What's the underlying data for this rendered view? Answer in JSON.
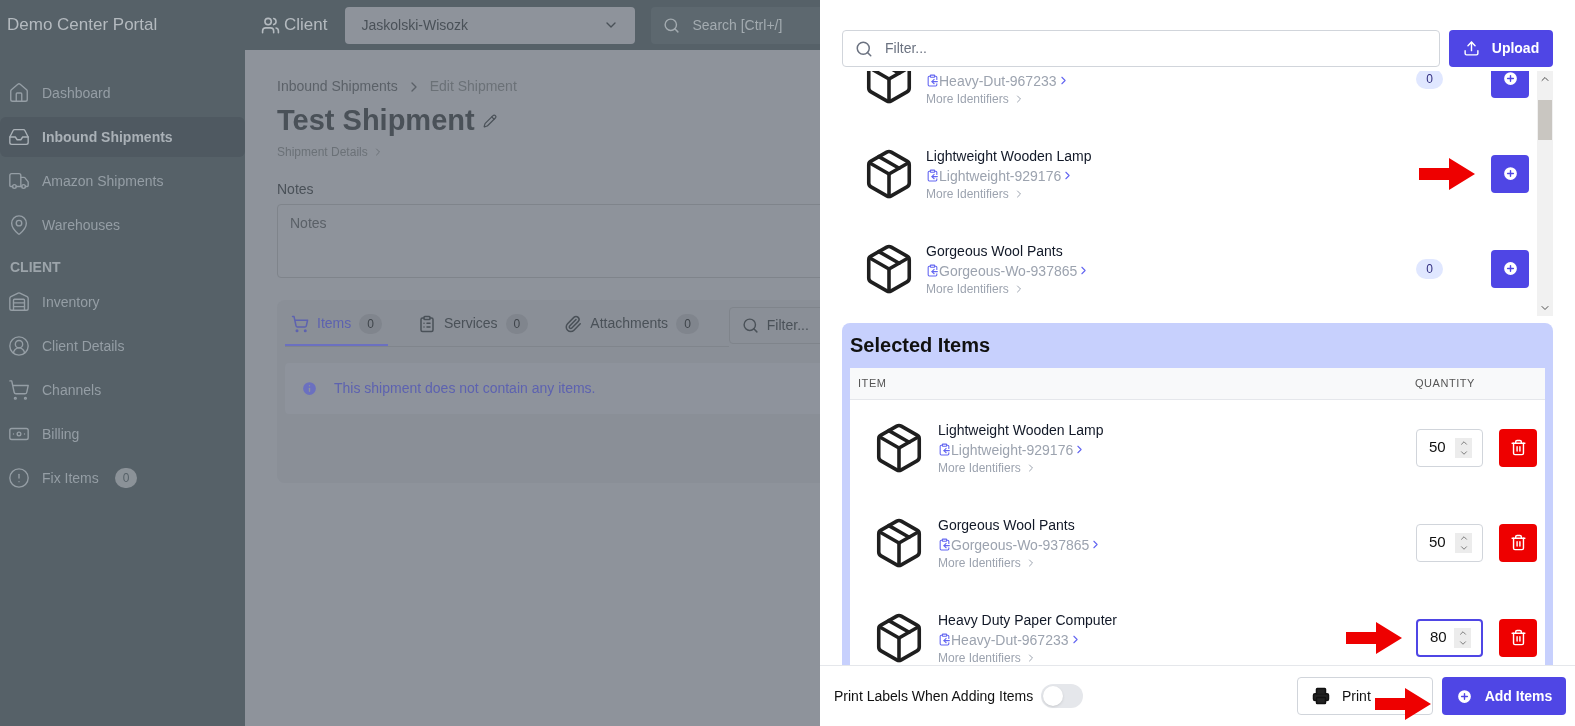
{
  "app": {
    "title": "Demo Center Portal",
    "client_label": "Client",
    "client_select": "Jaskolski-Wisozk",
    "search": {
      "placeholder": "Search [Ctrl+/]"
    }
  },
  "sidebar": {
    "items": [
      {
        "label": "Dashboard",
        "selected": false
      },
      {
        "label": "Inbound Shipments",
        "selected": true
      },
      {
        "label": "Amazon Shipments",
        "selected": false
      },
      {
        "label": "Warehouses",
        "selected": false
      }
    ],
    "section": "CLIENT",
    "client_items": [
      {
        "label": "Inventory",
        "selected": false
      },
      {
        "label": "Client Details",
        "selected": false
      },
      {
        "label": "Channels",
        "selected": false
      },
      {
        "label": "Billing",
        "selected": false
      },
      {
        "label": "Fix Items",
        "selected": false,
        "badge": "0"
      }
    ]
  },
  "page": {
    "breadcrumb": [
      "Inbound Shipments",
      "Edit Shipment"
    ],
    "title": "Test Shipment",
    "subtitle": "Shipment Details",
    "notes_label": "Notes",
    "notes_placeholder": "Notes",
    "tabs": [
      {
        "label": "Items",
        "count": "0",
        "selected": true
      },
      {
        "label": "Services",
        "count": "0",
        "selected": false
      },
      {
        "label": "Attachments",
        "count": "0",
        "selected": false
      }
    ],
    "filter_placeholder": "Filter...",
    "empty_message": "This shipment does not contain any items."
  },
  "drawer": {
    "filter_placeholder": "Filter...",
    "upload": "Upload",
    "catalog": [
      {
        "sku": "Heavy-Dut-967233",
        "more": "More Identifiers",
        "count": "0",
        "arrow": false
      },
      {
        "name": "Lightweight Wooden Lamp",
        "sku": "Lightweight-929176",
        "more": "More Identifiers",
        "arrow": true
      },
      {
        "name": "Gorgeous Wool Pants",
        "sku": "Gorgeous-Wo-937865",
        "more": "More Identifiers",
        "count": "0",
        "arrow": false
      }
    ],
    "selected_title": "Selected Items",
    "columns": [
      "ITEM",
      "QUANTITY"
    ],
    "selected": [
      {
        "name": "Lightweight Wooden Lamp",
        "sku": "Lightweight-929176",
        "more": "More Identifiers",
        "quantity": "50",
        "focused": false,
        "arrow": false
      },
      {
        "name": "Gorgeous Wool Pants",
        "sku": "Gorgeous-Wo-937865",
        "more": "More Identifiers",
        "quantity": "50",
        "focused": false,
        "arrow": false
      },
      {
        "name": "Heavy Duty Paper Computer",
        "sku": "Heavy-Dut-967233",
        "more": "More Identifiers",
        "quantity": "80",
        "focused": true,
        "arrow": true
      }
    ],
    "footer": {
      "toggle_label": "Print Labels When Adding Items",
      "toggle_on": false,
      "print": "Print",
      "print_arrow": true,
      "add": "Add Items"
    }
  }
}
